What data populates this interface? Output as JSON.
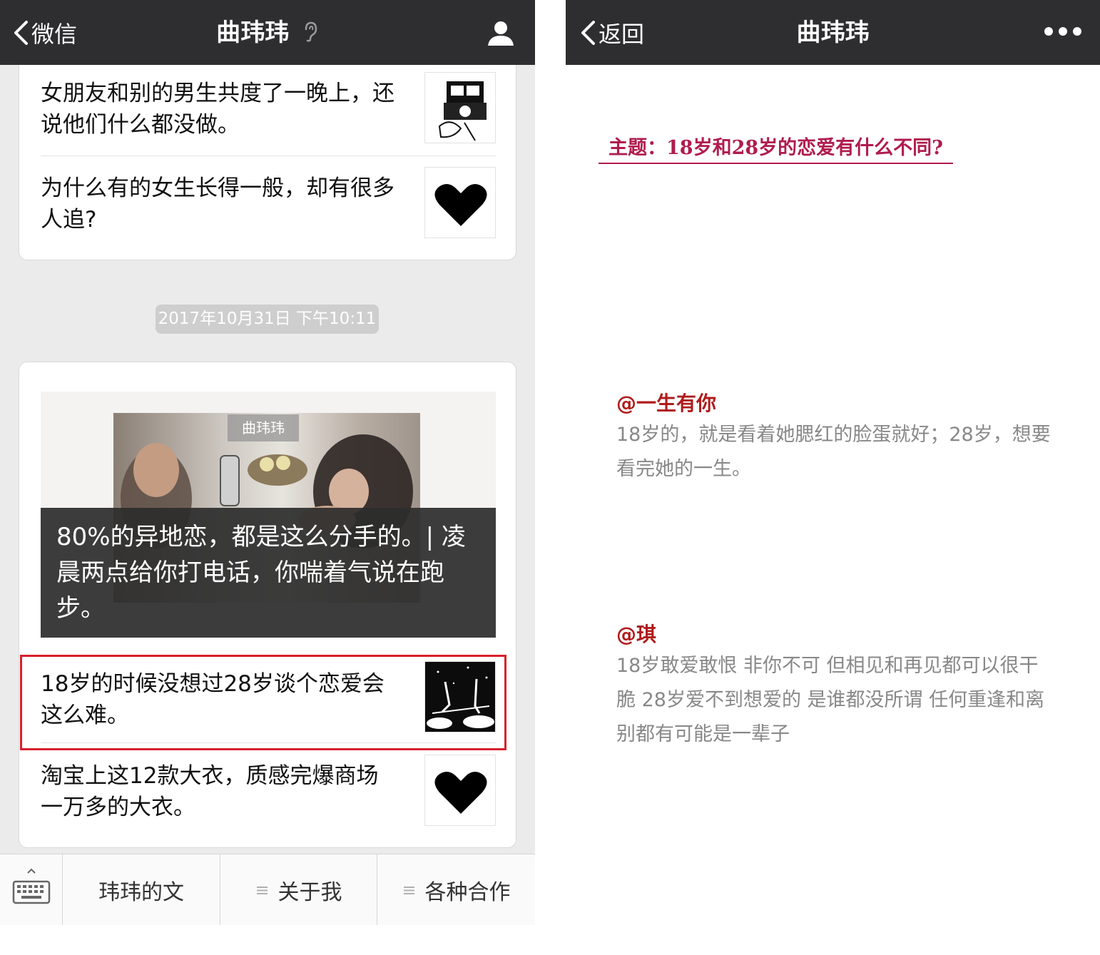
{
  "left": {
    "navbar": {
      "back_label": "微信",
      "title": "曲玮玮"
    },
    "card1": {
      "articles": [
        {
          "title": "女朋友和别的男生共度了一晚上，还说他们什么都没做。"
        },
        {
          "title": "为什么有的女生长得一般，却有很多人追?"
        }
      ]
    },
    "timestamp": "2017年10月31日 下午10:11",
    "card2": {
      "cover": {
        "watermark": "曲玮玮",
        "title": "80%的异地恋，都是这么分手的。| 凌晨两点给你打电话，你喘着气说在跑步。"
      },
      "articles": [
        {
          "title": "18岁的时候没想过28岁谈个恋爱会这么难。"
        },
        {
          "title": "淘宝上这12款大衣，质感完爆商场一万多的大衣。"
        }
      ]
    },
    "menu": {
      "items": [
        {
          "label": "玮玮的文"
        },
        {
          "label": "关于我"
        },
        {
          "label": "各种合作"
        }
      ]
    },
    "colors": {
      "highlight_border": "#d6202b",
      "navbar_bg": "#2e2e31"
    }
  },
  "right": {
    "navbar": {
      "back_label": "返回",
      "title": "曲玮玮"
    },
    "topic": "主题：18岁和28岁的恋爱有什么不同?",
    "comments": [
      {
        "handle": "@一生有你",
        "text": "18岁的，就是看着她腮红的脸蛋就好；28岁，想要看完她的一生。"
      },
      {
        "handle": "@琪",
        "text": "18岁敢爱敢恨 非你不可 但相见和再见都可以很干脆 28岁爱不到想爱的 是谁都没所谓 任何重逢和离别都有可能是一辈子"
      }
    ],
    "colors": {
      "topic": "#b01c4d",
      "handle": "#b01c1c",
      "quote": "#888888"
    }
  }
}
